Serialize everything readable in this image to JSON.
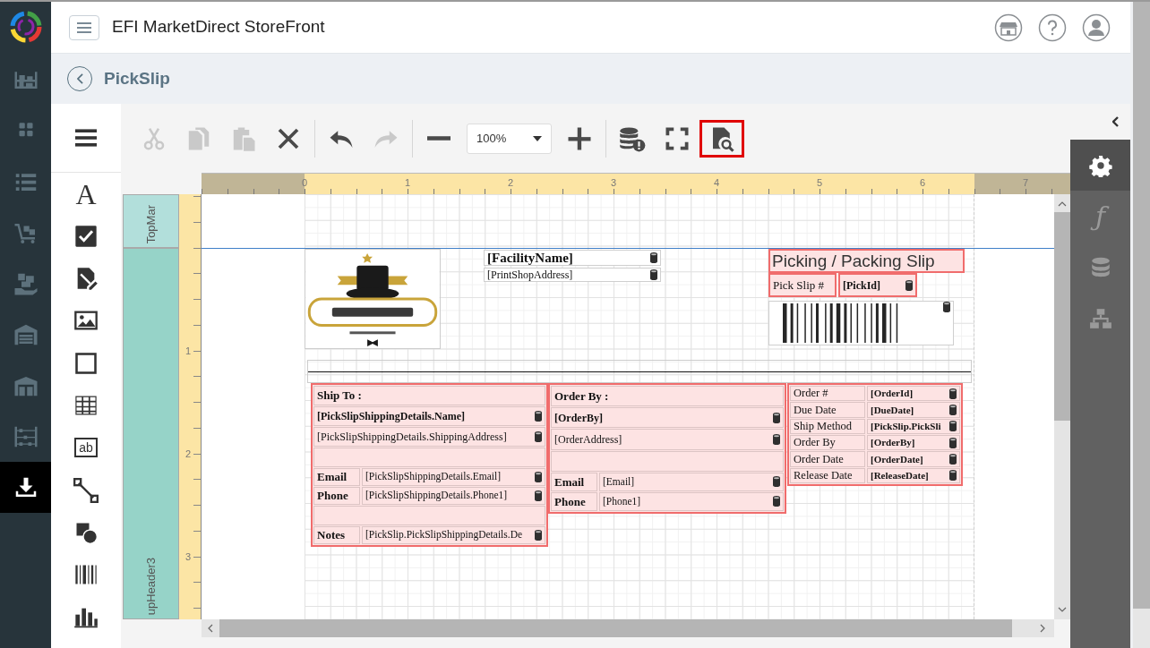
{
  "app": {
    "title": "EFI MarketDirect StoreFront"
  },
  "nav": [
    {
      "selected": false
    },
    {
      "selected": false
    },
    {
      "selected": false
    },
    {
      "selected": false
    },
    {
      "selected": false
    },
    {
      "selected": false
    },
    {
      "selected": false
    },
    {
      "selected": false
    },
    {
      "selected": true
    }
  ],
  "page": {
    "title": "PickSlip"
  },
  "toolbar": [
    {
      "kind": "button",
      "disabled": true,
      "highlighted": false
    },
    {
      "kind": "button",
      "disabled": true,
      "highlighted": false
    },
    {
      "kind": "button",
      "disabled": true,
      "highlighted": false
    },
    {
      "kind": "button",
      "disabled": false,
      "highlighted": false
    },
    {
      "kind": "separator"
    },
    {
      "kind": "button",
      "disabled": false,
      "highlighted": false
    },
    {
      "kind": "button",
      "disabled": true,
      "highlighted": false
    },
    {
      "kind": "separator"
    },
    {
      "kind": "button",
      "disabled": false,
      "highlighted": false
    },
    {
      "kind": "select",
      "value": "100%"
    },
    {
      "kind": "button",
      "disabled": false,
      "highlighted": false
    },
    {
      "kind": "separator"
    },
    {
      "kind": "button",
      "disabled": false,
      "highlighted": false
    },
    {
      "kind": "button",
      "disabled": false,
      "highlighted": false
    },
    {
      "kind": "button",
      "disabled": false,
      "highlighted": true
    }
  ],
  "toolbox": [
    {
      "kind": "glyph",
      "text": "A"
    },
    {
      "kind": "icon"
    },
    {
      "kind": "icon"
    },
    {
      "kind": "icon"
    },
    {
      "kind": "icon"
    },
    {
      "kind": "icon"
    },
    {
      "kind": "boxed",
      "text": "ab"
    },
    {
      "kind": "icon"
    },
    {
      "kind": "icon"
    },
    {
      "kind": "icon"
    },
    {
      "kind": "icon"
    }
  ],
  "ruler": {
    "marks": [
      "0",
      "1",
      "2",
      "3",
      "4",
      "5",
      "6",
      "7"
    ],
    "vmarks": [
      "1",
      "2",
      "3"
    ]
  },
  "bands": [
    {
      "label": "TopMar"
    },
    {
      "label": "upHeader3"
    }
  ],
  "report": [
    {
      "kind": "picture"
    },
    {
      "kind": "field",
      "text": "[FacilityName]",
      "bold": true,
      "bound": true,
      "flagged": false
    },
    {
      "kind": "field",
      "text": "[PrintShopAddress]",
      "bold": false,
      "bound": true,
      "flagged": false
    },
    {
      "kind": "title",
      "text": "Picking / Packing Slip",
      "flagged": true
    },
    {
      "kind": "label",
      "text": "Pick Slip #",
      "flagged": true
    },
    {
      "kind": "field",
      "text": "[PickId]",
      "bold": true,
      "bound": true,
      "flagged": true
    },
    {
      "kind": "barcode",
      "bound": true
    },
    {
      "kind": "line"
    },
    {
      "kind": "panel",
      "flagged": true,
      "rows": [
        {
          "kind": "heading",
          "text": "Ship To :"
        },
        {
          "kind": "value",
          "text": "[PickSlipShippingDetails.Name]",
          "bold": true,
          "bound": true
        },
        {
          "kind": "value",
          "text": "[PickSlipShippingDetails.ShippingAddress]",
          "bold": false,
          "bound": true
        },
        {
          "kind": "blank"
        },
        {
          "kind": "pair",
          "label": "Email",
          "text": "[PickSlipShippingDetails.Email]",
          "bold": false,
          "bound": true
        },
        {
          "kind": "pair",
          "label": "Phone",
          "text": "[PickSlipShippingDetails.Phone1]",
          "bold": false,
          "bound": true
        },
        {
          "kind": "blank"
        },
        {
          "kind": "pair",
          "label": "Notes",
          "text": "[PickSlip.PickSlipShippingDetails.De",
          "bold": false,
          "bound": true
        }
      ]
    },
    {
      "kind": "panel",
      "flagged": true,
      "rows": [
        {
          "kind": "heading",
          "text": "Order By :"
        },
        {
          "kind": "value",
          "text": "[OrderBy]",
          "bold": true,
          "bound": true
        },
        {
          "kind": "value",
          "text": "[OrderAddress]",
          "bold": false,
          "bound": true
        },
        {
          "kind": "blank"
        },
        {
          "kind": "pair",
          "label": "Email",
          "text": "[Email]",
          "bold": false,
          "bound": true
        },
        {
          "kind": "pair",
          "label": "Phone",
          "text": "[Phone1]",
          "bold": false,
          "bound": true
        }
      ]
    },
    {
      "kind": "table",
      "flagged": true,
      "rows": [
        {
          "kind": "pair",
          "label": "Order #",
          "text": "[OrderId]",
          "bold": true,
          "bound": true
        },
        {
          "kind": "pair",
          "label": "Due Date",
          "text": "[DueDate]",
          "bold": true,
          "bound": true
        },
        {
          "kind": "pair",
          "label": "Ship Method",
          "text": "[PickSlip.PickSli",
          "bold": true,
          "bound": true
        },
        {
          "kind": "pair",
          "label": "Order By",
          "text": "[OrderBy]",
          "bold": true,
          "bound": true
        },
        {
          "kind": "pair",
          "label": "Order Date",
          "text": "[OrderDate]",
          "bold": true,
          "bound": true
        },
        {
          "kind": "pair",
          "label": "Release Date",
          "text": "[ReleaseDate]",
          "bold": true,
          "bound": true
        }
      ]
    }
  ],
  "side_tabs": [
    {
      "kind": "icon",
      "selected": true
    },
    {
      "kind": "glyph",
      "text": "ƒ",
      "selected": false
    },
    {
      "kind": "icon",
      "selected": false
    },
    {
      "kind": "icon",
      "selected": false
    }
  ]
}
